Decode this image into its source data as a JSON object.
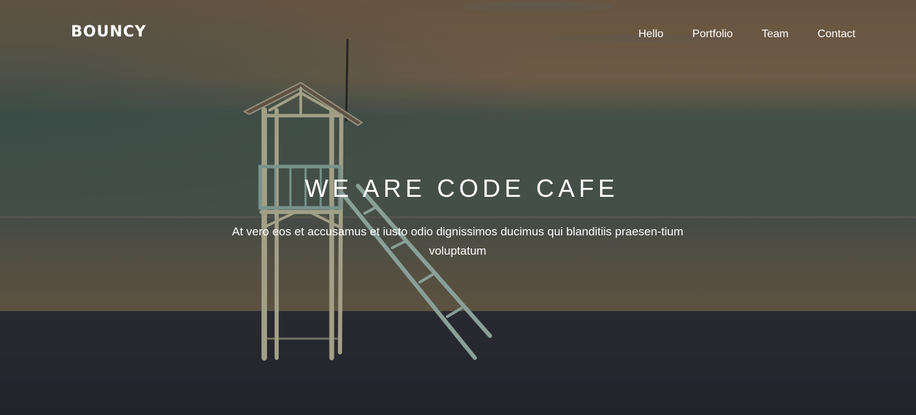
{
  "brand": {
    "logo_text": "BOUNCY"
  },
  "nav": {
    "items": [
      {
        "label": "Hello"
      },
      {
        "label": "Portfolio"
      },
      {
        "label": "Team"
      },
      {
        "label": "Contact"
      }
    ]
  },
  "hero": {
    "headline": "WE ARE CODE CAFE",
    "subtext": "At vero eos et accusamus et iusto odio dignissimos ducimus qui blanditiis praesen-tium voluptatum",
    "background_image": "lifeguard-tower-on-beach-at-dusk"
  },
  "colors": {
    "sky_top": "#7a6348",
    "sky_mid": "#7f6950",
    "horizon": "#4f5a52",
    "sea": "#5a5b4e",
    "sand": "#2b2d38",
    "text": "#ffffff"
  }
}
